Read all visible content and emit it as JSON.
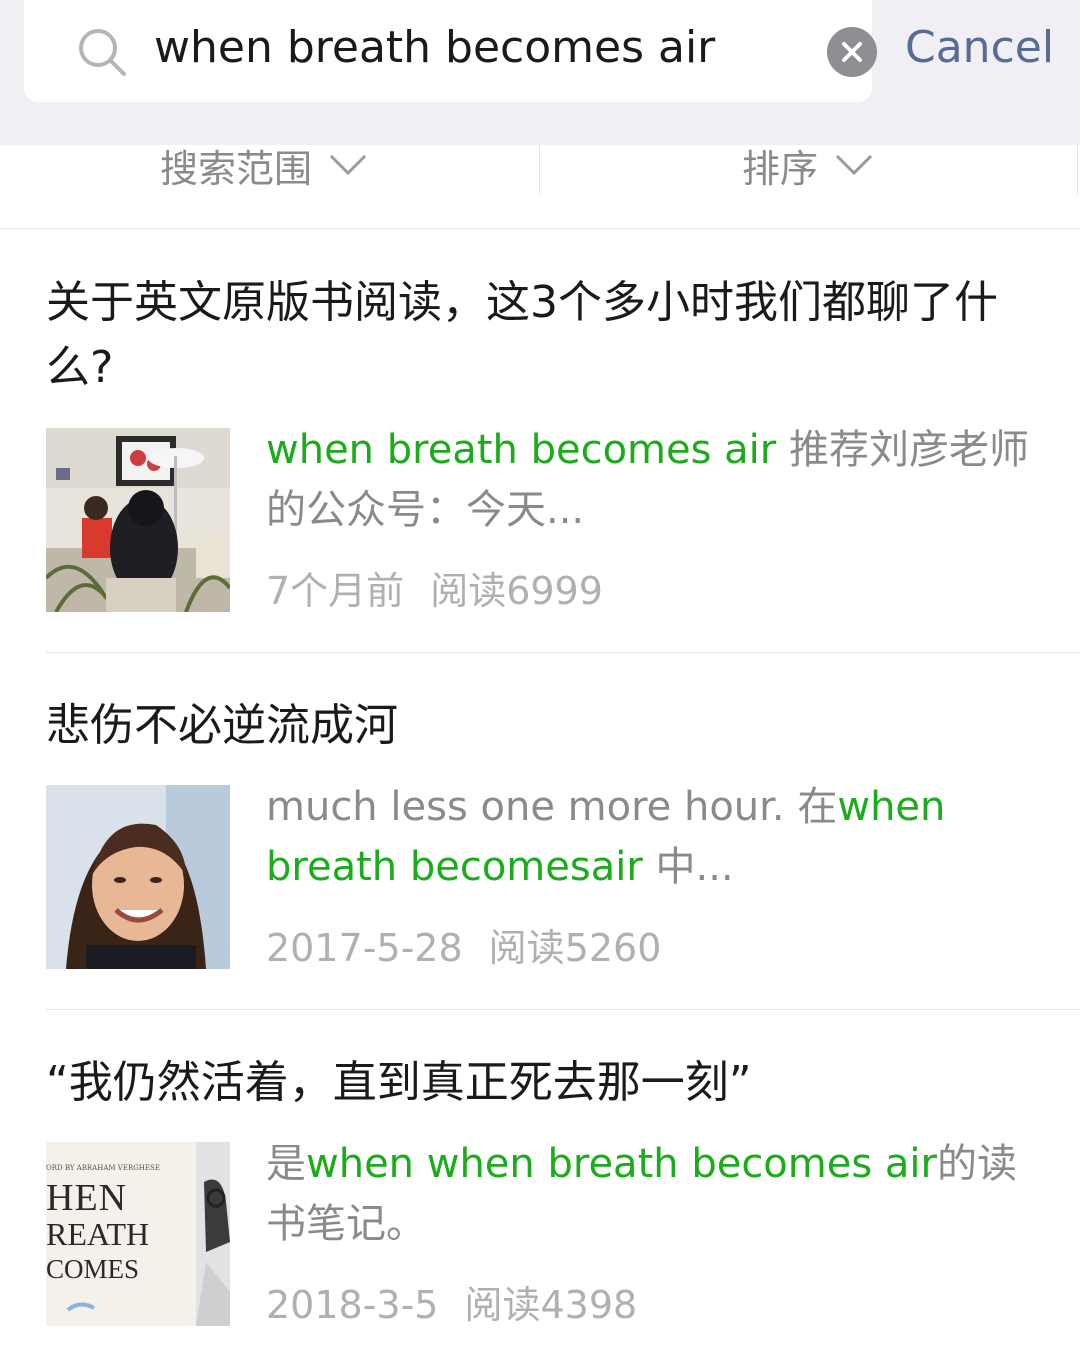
{
  "search": {
    "query": "when breath becomes air",
    "cancel_label": "Cancel"
  },
  "filters": {
    "range_label": "搜索范围",
    "sort_label": "排序"
  },
  "colors": {
    "highlight": "#1aad19",
    "cancel": "#576b95",
    "meta": "#b0b0b0"
  },
  "results": [
    {
      "title": "关于英文原版书阅读，这3个多小时我们都聊了什么?",
      "snippet_parts": [
        {
          "text": "when breath becomes air",
          "highlight": true
        },
        {
          "text": " 推荐刘彦老师的公众号：今天...",
          "highlight": false
        }
      ],
      "date": "7个月前",
      "reads": "阅读6999"
    },
    {
      "title": "悲伤不必逆流成河",
      "snippet_parts": [
        {
          "text": "much less one more hour. 在",
          "highlight": false
        },
        {
          "text": "when breath becomesair",
          "highlight": true
        },
        {
          "text": " 中...",
          "highlight": false
        }
      ],
      "date": "2017-5-28",
      "reads": "阅读5260"
    },
    {
      "title": "“我仍然活着，直到真正死去那一刻”",
      "snippet_parts": [
        {
          "text": "是",
          "highlight": false
        },
        {
          "text": "when when breath becomes air",
          "highlight": true
        },
        {
          "text": "的读书笔记。",
          "highlight": false
        }
      ],
      "date": "2018-3-5",
      "reads": "阅读4398",
      "thumb_text": {
        "byline": "ORD BY ABRAHAM VERGHESE",
        "line1": "HEN",
        "line2": "REATH",
        "line3": "COMES"
      }
    }
  ]
}
